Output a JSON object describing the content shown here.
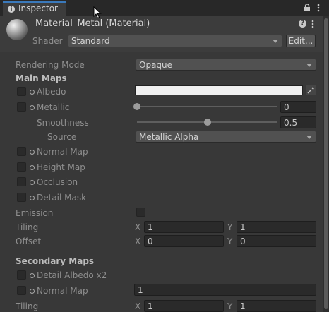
{
  "tab": {
    "title": "Inspector"
  },
  "header": {
    "material_title": "Material_Metal (Material)",
    "shader_label": "Shader",
    "shader_value": "Standard",
    "edit_label": "Edit..."
  },
  "rendering_mode": {
    "label": "Rendering Mode",
    "value": "Opaque"
  },
  "main_maps": {
    "heading": "Main Maps",
    "albedo": "Albedo",
    "metallic": "Metallic",
    "metallic_value": "0",
    "smoothness": "Smoothness",
    "smoothness_value": "0.5",
    "source": "Source",
    "source_value": "Metallic Alpha",
    "normal_map": "Normal Map",
    "height_map": "Height Map",
    "occlusion": "Occlusion",
    "detail_mask": "Detail Mask",
    "emission": "Emission",
    "tiling": {
      "label": "Tiling",
      "x_label": "X",
      "x": "1",
      "y_label": "Y",
      "y": "1"
    },
    "offset": {
      "label": "Offset",
      "x_label": "X",
      "x": "0",
      "y_label": "Y",
      "y": "0"
    }
  },
  "secondary_maps": {
    "heading": "Secondary Maps",
    "detail_albedo": "Detail Albedo x2",
    "normal_map": "Normal Map",
    "normal_value": "1",
    "tiling": {
      "label": "Tiling",
      "x_label": "X",
      "x": "1",
      "y_label": "Y",
      "y": "1"
    }
  },
  "sliders": {
    "metallic_fraction": 0.0,
    "smoothness_fraction": 0.5
  },
  "colors": {
    "accent": "#3a79bb",
    "albedo": "#f0f0f0",
    "panel": "#383838"
  },
  "icons": [
    "info-icon",
    "lock-icon",
    "kebab-menu-icon",
    "help-icon",
    "eyedropper-icon",
    "chevron-down-icon",
    "material-sphere-icon"
  ]
}
